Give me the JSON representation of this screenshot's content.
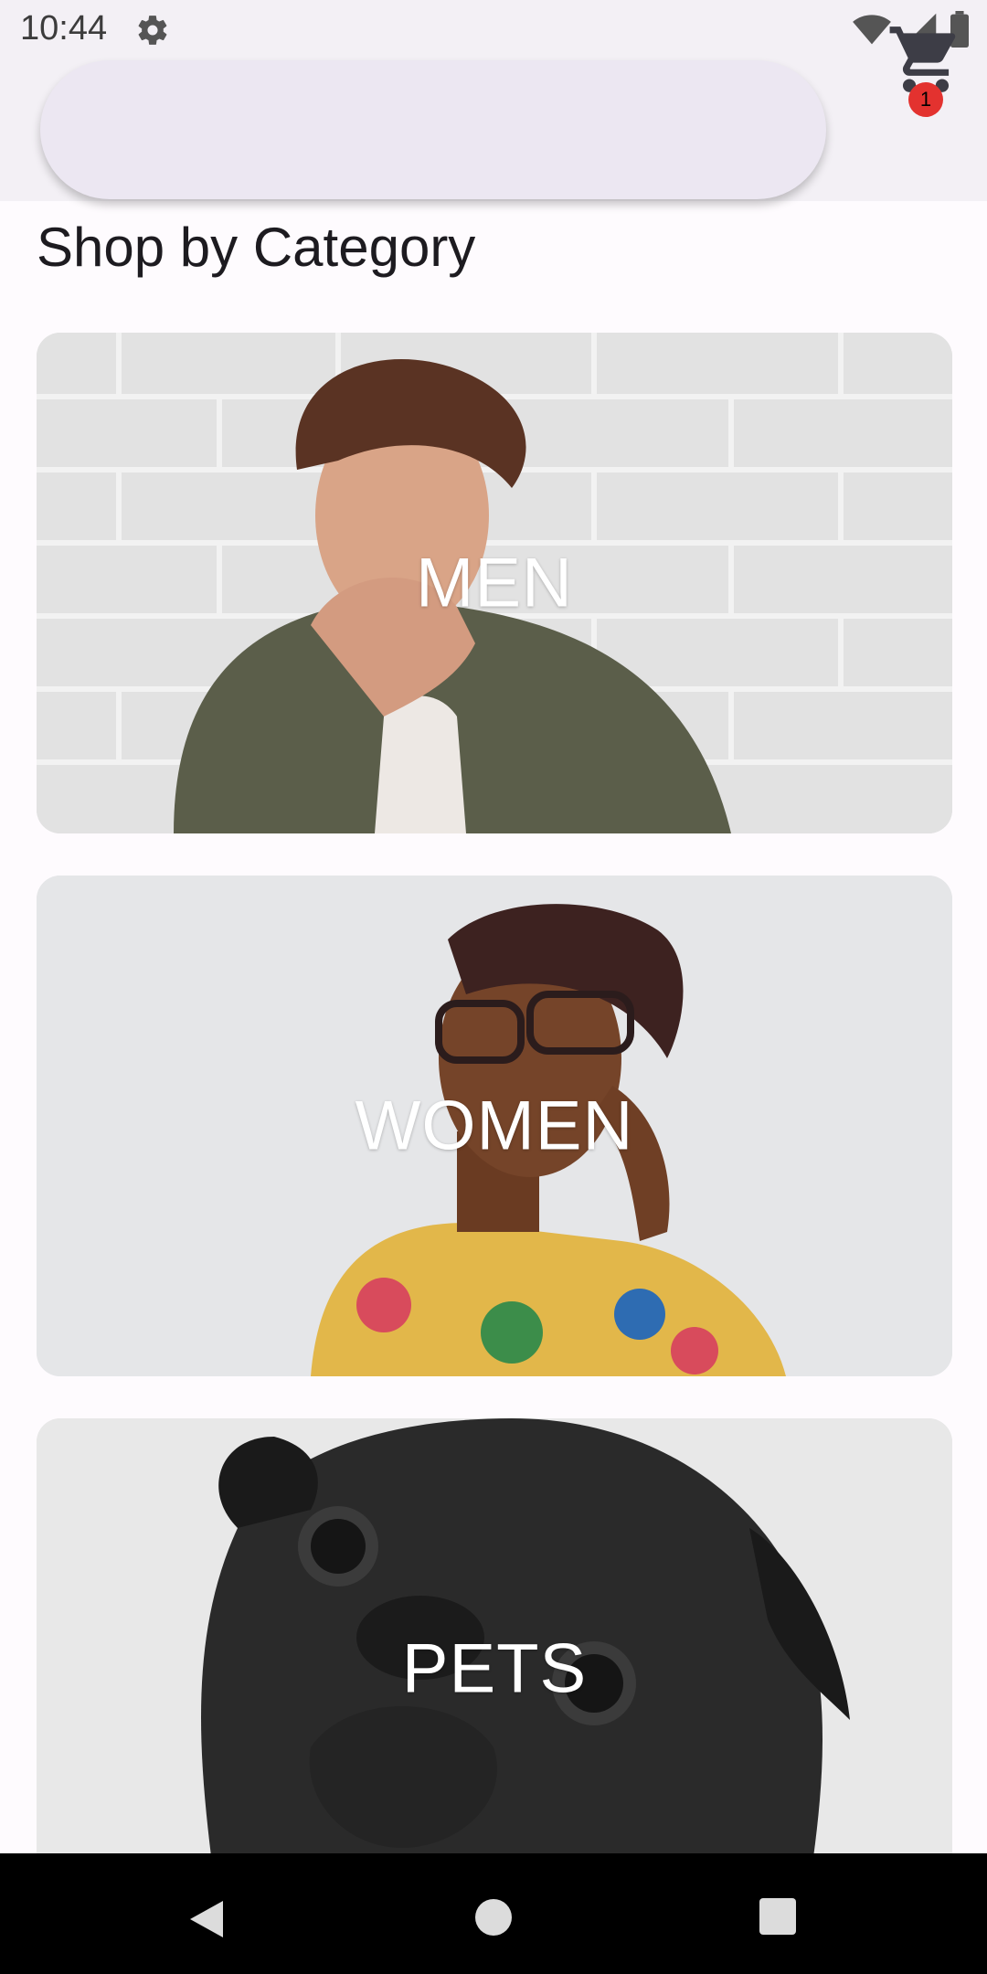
{
  "status_bar": {
    "time": "10:44",
    "icons": [
      "gear-icon",
      "wifi-icon",
      "signal-icon",
      "battery-icon"
    ]
  },
  "app_bar": {
    "search_placeholder": "",
    "cart_badge_count": "1"
  },
  "main": {
    "section_title": "Shop by Category",
    "categories": [
      {
        "label": "MEN"
      },
      {
        "label": "WOMEN"
      },
      {
        "label": "PETS"
      }
    ]
  },
  "nav_bar": {
    "buttons": [
      "back-icon",
      "home-icon",
      "recents-icon"
    ]
  },
  "colors": {
    "badge": "#e3322f",
    "app_bar_bg": "#f3f0f5",
    "search_bg": "#ece7f2"
  }
}
